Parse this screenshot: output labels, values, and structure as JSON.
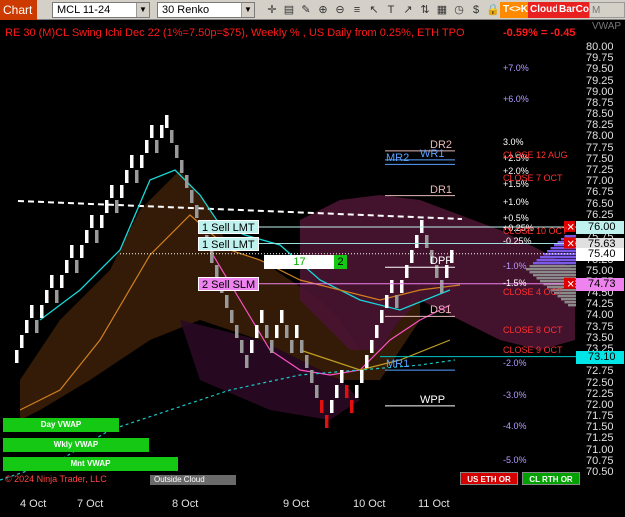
{
  "toolbar": {
    "chart_button": "Chart",
    "symbol": "MCL 11-24",
    "bar_type": "30 Renko",
    "tk_button": "T<>K",
    "cloud_button": "Cloud",
    "barcol_button": "BarCol",
    "m_button": "M VWAP",
    "tool_icons": [
      "crosshair-icon",
      "data-box-icon",
      "pencil-icon",
      "magnifier-plus-icon",
      "magnifier-minus-icon",
      "lines-icon",
      "cursor-icon",
      "text-icon",
      "arrow-icon",
      "trade-icon",
      "grid-icon",
      "clock-icon",
      "dollar-icon",
      "lock-icon"
    ]
  },
  "header": {
    "title": "RE 30 (M)CL Swing Ichi Dec 22  (1%=7.50p=$75), Weekly % , US Daily from 0.25%, ETH TPO",
    "change": "-0.59% = -0.45"
  },
  "price_axis": [
    "80.00",
    "79.75",
    "79.50",
    "79.25",
    "79.00",
    "78.75",
    "78.50",
    "78.25",
    "78.00",
    "77.75",
    "77.50",
    "77.25",
    "77.00",
    "76.75",
    "76.50",
    "76.25",
    "76.00",
    "75.75",
    "75.50",
    "75.25",
    "75.00",
    "74.75",
    "74.50",
    "74.25",
    "74.00",
    "73.75",
    "73.50",
    "73.25",
    "73.00",
    "72.75",
    "72.50",
    "72.25",
    "72.00",
    "71.75",
    "71.50",
    "71.25",
    "71.00",
    "70.75",
    "70.50"
  ],
  "price_tags": [
    {
      "value": "76.00",
      "price": 76.0,
      "color": "#bff2ee"
    },
    {
      "value": "75.63",
      "price": 75.63,
      "color": "#e0e0e0"
    },
    {
      "value": "75.40",
      "price": 75.4,
      "color": "#ffffff"
    },
    {
      "value": "74.73",
      "price": 74.73,
      "color": "#ee82ee"
    },
    {
      "value": "73.10",
      "price": 73.1,
      "color": "#00e5e5"
    }
  ],
  "x_axis": [
    {
      "label": "4 Oct",
      "slot": 0
    },
    {
      "label": "7 Oct",
      "slot": 1
    },
    {
      "label": "8 Oct",
      "slot": 2
    },
    {
      "label": "9 Oct",
      "slot": 3
    },
    {
      "label": "10 Oct",
      "slot": 4
    },
    {
      "label": "11 Oct",
      "slot": 5
    }
  ],
  "orders": [
    {
      "label": "1 Sell LMT",
      "price": 76.0,
      "kind": "lmt"
    },
    {
      "label": "1 Sell LMT",
      "price": 75.63,
      "kind": "lmt"
    },
    {
      "label": "2 Sell SLM",
      "price": 74.73,
      "kind": "slm"
    }
  ],
  "quantity": {
    "value": "17",
    "step": "2"
  },
  "pivot_levels": [
    {
      "label": "DR2",
      "price": 77.7,
      "color": "#e6b8b8"
    },
    {
      "label": "WR1",
      "price": 77.5,
      "color": "#5aa0ff"
    },
    {
      "label": "MR2",
      "price": 77.4,
      "color": "#5aa0ff"
    },
    {
      "label": "DR1",
      "price": 76.7,
      "color": "#e6b8b8"
    },
    {
      "label": "DPP",
      "price": 75.1,
      "color": "#ffffff"
    },
    {
      "label": "DS1",
      "price": 74.0,
      "color": "#e6b8b8"
    },
    {
      "label": "MR1",
      "price": 72.8,
      "color": "#5aa0ff"
    },
    {
      "label": "WPP",
      "price": 72.0,
      "color": "#ffffff"
    }
  ],
  "pct_levels": [
    {
      "text": "+7.0%",
      "price": 79.55,
      "color": "#b69cff"
    },
    {
      "text": "+6.0%",
      "price": 78.85,
      "color": "#b69cff"
    },
    {
      "text": "3.0%",
      "price": 77.9,
      "color": "#ffffff"
    },
    {
      "text": "+2.5%",
      "price": 77.55,
      "color": "#ffffff"
    },
    {
      "text": "+2.0%",
      "price": 77.25,
      "color": "#ffffff"
    },
    {
      "text": "+1.5%",
      "price": 76.95,
      "color": "#ffffff"
    },
    {
      "text": "+1.0%",
      "price": 76.55,
      "color": "#ffffff"
    },
    {
      "text": "+0.5%",
      "price": 76.2,
      "color": "#ffffff"
    },
    {
      "text": "+0.25%",
      "price": 75.98,
      "color": "#ffffff"
    },
    {
      "text": "-0.25%",
      "price": 75.68,
      "color": "#ffffff"
    },
    {
      "text": "-1.0%",
      "price": 75.12,
      "color": "#b69cff"
    },
    {
      "text": "-1.5%",
      "price": 74.75,
      "color": "#ffffff"
    },
    {
      "text": "-2.0%",
      "price": 72.95,
      "color": "#b69cff"
    },
    {
      "text": "-3.0%",
      "price": 72.25,
      "color": "#b69cff"
    },
    {
      "text": "-4.0%",
      "price": 71.55,
      "color": "#b69cff"
    },
    {
      "text": "-5.0%",
      "price": 70.8,
      "color": "#b69cff"
    }
  ],
  "close_labels": [
    {
      "text": "CLOSE 12 AUG",
      "price": 77.6
    },
    {
      "text": "CLOSE 7 OCT",
      "price": 77.1
    },
    {
      "text": "CLOSE 10 OCT",
      "price": 75.9
    },
    {
      "text": "CLOSE 4 OCT",
      "price": 74.55
    },
    {
      "text": "CLOSE 8 OCT",
      "price": 73.7
    },
    {
      "text": "CLOSE 9 OCT",
      "price": 73.25
    }
  ],
  "vwap_buttons": [
    {
      "label": "Day VWAP",
      "width": 116
    },
    {
      "label": "Wkly VWAP",
      "width": 146
    },
    {
      "label": "Mnt VWAP",
      "width": 175
    }
  ],
  "outside_cloud": "Outside Cloud",
  "copyright": "© 2024 Ninja Trader, LLC",
  "session_buttons": [
    {
      "label": "US ETH OR",
      "bg": "#d40000"
    },
    {
      "label": "CL RTH OR",
      "bg": "#00a000"
    }
  ]
}
